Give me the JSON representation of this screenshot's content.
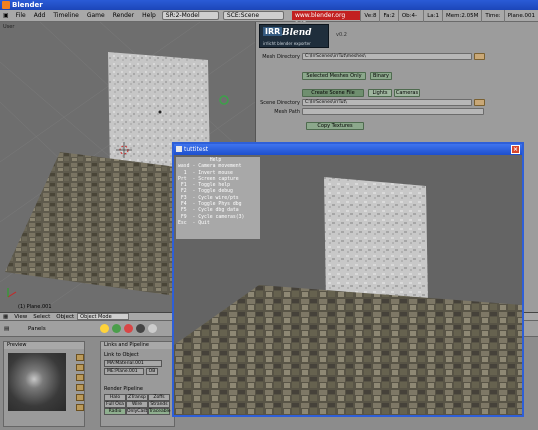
{
  "window": {
    "title": "Blender"
  },
  "menubar": {
    "items": [
      "File",
      "Add",
      "Timeline",
      "Game",
      "Render",
      "Help"
    ],
    "screen": "SR:2-Model",
    "scene": "SCE:Scene",
    "url": "www.blender.org 245",
    "stats": [
      "Ve:8",
      "Fa:2",
      "Ob:4-0",
      "La:1",
      "Mem:2.05M",
      "Time:",
      "Plane.001"
    ]
  },
  "viewport": {
    "label": "User",
    "object_label": "(1) Plane.001"
  },
  "script_panel": {
    "logo_irr": "IRR",
    "logo_blend": "Blend",
    "logo_sub": "irrlicht blender exporter",
    "version": "v0.2",
    "mesh_dir_label": "Mesh Directory",
    "mesh_dir_value": "C:\\IrrScenes\\irrTut\\meshes\\",
    "selected_meshes_only": "Selected Meshes Only",
    "binary": "Binary",
    "create_scene_file": "Create Scene File",
    "lights": "Lights",
    "cameras": "Cameras",
    "scene_dir_label": "Scene Directory",
    "scene_dir_value": "C:\\IrrScenes\\irrTut\\",
    "mesh_path_label": "Mesh Path",
    "copy_textures": "Copy Textures"
  },
  "header2": {
    "items": [
      "View",
      "Select",
      "Object"
    ],
    "mode": "Object Mode"
  },
  "header3": {
    "panels": "Panels"
  },
  "buttons": {
    "preview_title": "Preview",
    "links_title": "Links and Pipeline",
    "link_to_object": "Link to Object",
    "material_name": "MA:Material.001",
    "mesh_name": "ME:Plane.001",
    "ob_label": "OB",
    "render_pipeline": "Render Pipeline",
    "row1": [
      "Halo",
      "ZTransp",
      "Zoffs"
    ],
    "row2": [
      "Full Osa",
      "Wire",
      "Strands"
    ],
    "row3": [
      "Radio",
      "OnlyCast",
      "Traceable"
    ]
  },
  "tuttitest": {
    "title": "tuttitest",
    "help_lines": [
      "           Help",
      "wasd - Camera movement",
      "  1  - Invert mouse",
      "Prt  - Screen capture",
      " F1  - Toggle help",
      " F2  - Toggle debug",
      " F3  - Cycle wire/pts",
      " F4  - Toggle Phys dbg",
      " F5  - Cycle dbg data",
      " F9  - Cycle cameras(3)",
      "Esc  - Quit"
    ]
  }
}
